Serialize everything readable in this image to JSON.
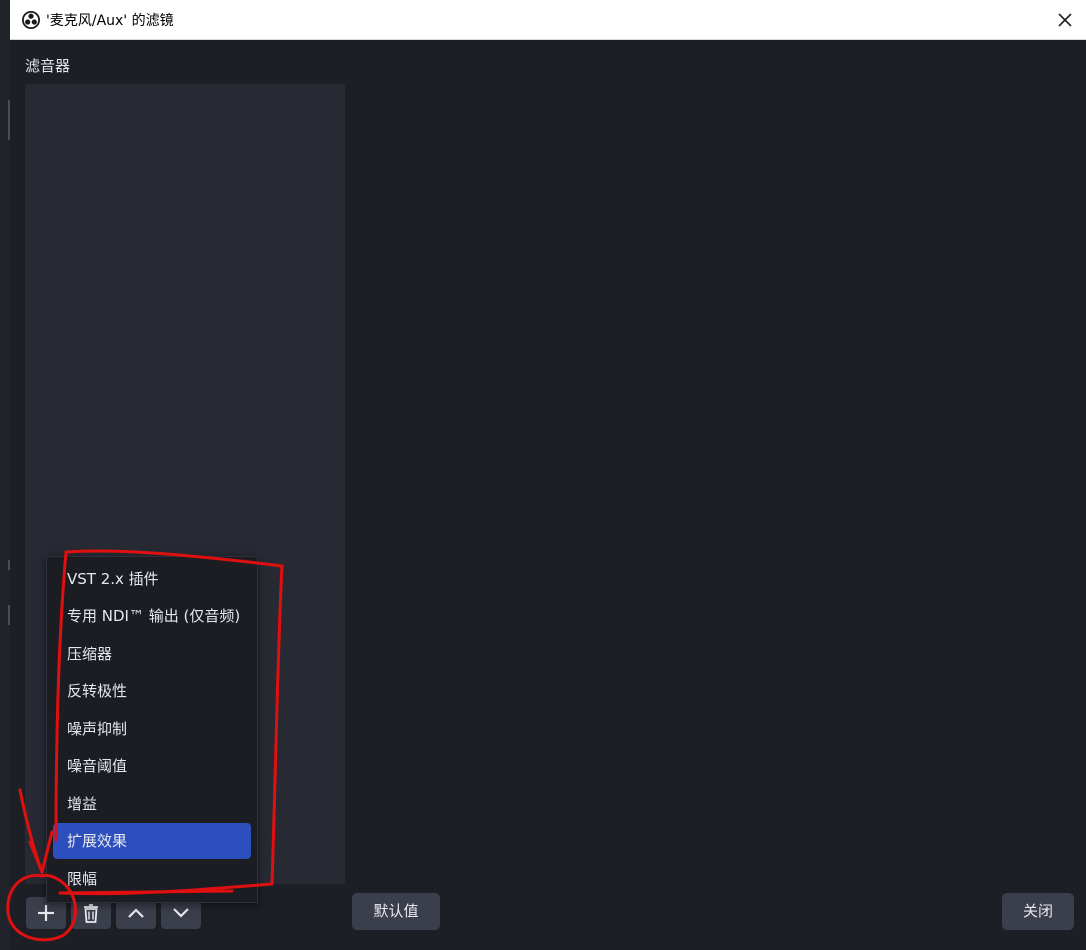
{
  "window": {
    "title": "'麦克风/Aux' 的滤镜"
  },
  "filters_section": {
    "label": "滤音器"
  },
  "add_menu": {
    "items": [
      "VST 2.x 插件",
      "专用 NDI™ 输出 (仅音频)",
      "压缩器",
      "反转极性",
      "噪声抑制",
      "噪音阈值",
      "增益",
      "扩展效果",
      "限幅"
    ],
    "highlighted_index": 7
  },
  "buttons": {
    "defaults_label": "默认值",
    "close_label": "关闭"
  },
  "icons": {
    "add": "plus-icon",
    "remove": "trash-icon",
    "move_up": "chevron-up-icon",
    "move_down": "chevron-down-icon"
  },
  "colors": {
    "background": "#1d1f26",
    "panel": "#272a33",
    "button": "#3b3f4b",
    "highlight": "#2d4fbd",
    "annotation": "#e01010"
  }
}
